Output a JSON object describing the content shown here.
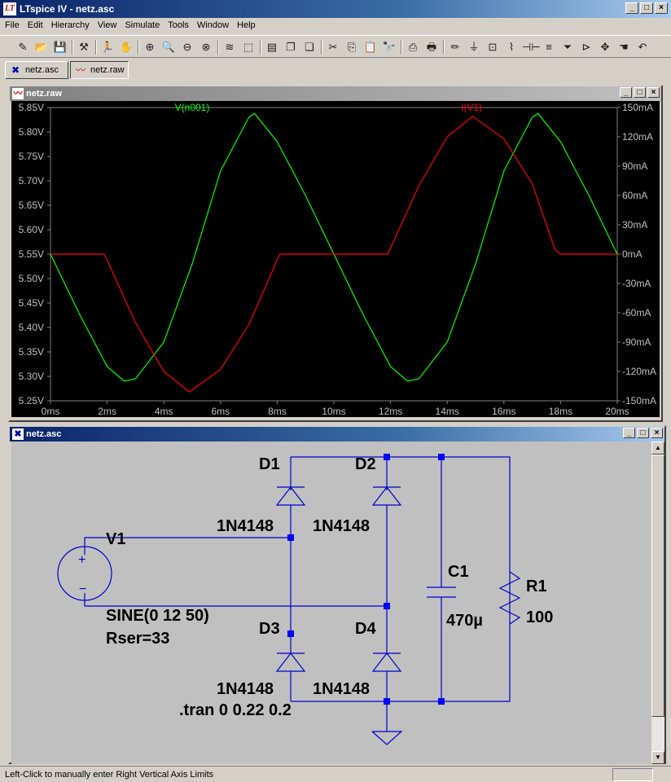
{
  "window": {
    "title": "LTspice IV - netz.asc",
    "app_icon_glyph": "LT"
  },
  "menu": [
    "File",
    "Edit",
    "Hierarchy",
    "View",
    "Simulate",
    "Tools",
    "Window",
    "Help"
  ],
  "toolbar": [
    {
      "icon": "new-schematic-icon",
      "glyph": "✎"
    },
    {
      "icon": "open-icon",
      "glyph": "📂"
    },
    {
      "icon": "save-icon",
      "glyph": "💾"
    },
    {
      "icon": "control-panel-icon",
      "glyph": "⚒"
    },
    {
      "icon": "run-icon",
      "glyph": "🏃"
    },
    {
      "icon": "halt-icon",
      "glyph": "✋"
    },
    {
      "icon": "zoom-in-icon",
      "glyph": "⊕"
    },
    {
      "icon": "pan-icon",
      "glyph": "🔍"
    },
    {
      "icon": "zoom-out-icon",
      "glyph": "⊖"
    },
    {
      "icon": "zoom-cancel-icon",
      "glyph": "⊗"
    },
    {
      "icon": "autorange-icon",
      "glyph": "≋"
    },
    {
      "icon": "fit-icon",
      "glyph": "⬚"
    },
    {
      "icon": "tile-horizontal-icon",
      "glyph": "▤"
    },
    {
      "icon": "cascade-icon",
      "glyph": "❐"
    },
    {
      "icon": "close-windows-icon",
      "glyph": "❏"
    },
    {
      "icon": "cut-icon",
      "glyph": "✂"
    },
    {
      "icon": "copy-icon",
      "glyph": "⎘"
    },
    {
      "icon": "paste-icon",
      "glyph": "📋"
    },
    {
      "icon": "find-icon",
      "glyph": "🔭"
    },
    {
      "icon": "print-setup-icon",
      "glyph": "⎙"
    },
    {
      "icon": "print-icon",
      "glyph": "🖶"
    },
    {
      "icon": "wire-icon",
      "glyph": "✏"
    },
    {
      "icon": "ground-icon",
      "glyph": "⏚"
    },
    {
      "icon": "label-net-icon",
      "glyph": "⊡"
    },
    {
      "icon": "resistor-icon",
      "glyph": "⌇"
    },
    {
      "icon": "capacitor-icon",
      "glyph": "⊣⊢"
    },
    {
      "icon": "inductor-icon",
      "glyph": "≡"
    },
    {
      "icon": "diode-icon",
      "glyph": "⏷"
    },
    {
      "icon": "component-icon",
      "glyph": "⊳"
    },
    {
      "icon": "move-icon",
      "glyph": "✥"
    },
    {
      "icon": "drag-icon",
      "glyph": "☚"
    },
    {
      "icon": "undo-icon",
      "glyph": "↶"
    }
  ],
  "tabs": [
    {
      "label": "netz.asc",
      "icon": "schematic-tab-icon"
    },
    {
      "label": "netz.raw",
      "icon": "waveform-tab-icon"
    }
  ],
  "plot_window": {
    "title": "netz.raw"
  },
  "schematic_window": {
    "title": "netz.asc"
  },
  "chart_data": {
    "type": "line",
    "title": "",
    "xlabel": "",
    "xlim": [
      0,
      20
    ],
    "x_ticks": [
      "0ms",
      "2ms",
      "4ms",
      "6ms",
      "8ms",
      "10ms",
      "12ms",
      "14ms",
      "16ms",
      "18ms",
      "20ms"
    ],
    "left_axis": {
      "ylim": [
        5.25,
        5.85
      ],
      "ticks": [
        "5.85V",
        "5.80V",
        "5.75V",
        "5.70V",
        "5.65V",
        "5.60V",
        "5.55V",
        "5.50V",
        "5.45V",
        "5.40V",
        "5.35V",
        "5.30V",
        "5.25V"
      ]
    },
    "right_axis": {
      "ylim": [
        -150,
        150
      ],
      "ticks": [
        "150mA",
        "120mA",
        "90mA",
        "60mA",
        "30mA",
        "0mA",
        "-30mA",
        "-60mA",
        "-90mA",
        "-120mA",
        "-150mA"
      ]
    },
    "background": "#000000",
    "grid": false,
    "series": [
      {
        "name": "V(n001)",
        "axis": "left",
        "color": "#00ff00",
        "x": [
          0,
          1,
          2,
          2.6,
          3,
          4,
          5,
          6,
          7,
          7.2,
          8,
          9,
          10,
          11,
          12,
          12.6,
          13,
          14,
          15,
          16,
          17,
          17.2,
          18,
          19,
          20
        ],
        "y": [
          5.55,
          5.43,
          5.32,
          5.29,
          5.295,
          5.37,
          5.53,
          5.72,
          5.83,
          5.838,
          5.78,
          5.67,
          5.55,
          5.43,
          5.32,
          5.29,
          5.295,
          5.37,
          5.53,
          5.72,
          5.83,
          5.838,
          5.78,
          5.67,
          5.55
        ]
      },
      {
        "name": "I(V1)",
        "axis": "right",
        "color": "#ff0000",
        "x": [
          0,
          1,
          1.9,
          3,
          4,
          4.9,
          6,
          7,
          8,
          8.1,
          10,
          11,
          11.9,
          13,
          14,
          14.9,
          16,
          17,
          17.8,
          18,
          20
        ],
        "y": [
          0,
          0,
          0,
          -70,
          -120,
          -141,
          -118,
          -72,
          -6,
          0,
          0,
          0,
          0,
          70,
          120,
          141,
          118,
          72,
          5,
          0,
          0
        ]
      }
    ]
  },
  "schematic": {
    "labels": {
      "v1": "V1",
      "v1_spec1": "SINE(0 12 50)",
      "v1_spec2": "Rser=33",
      "d1": "D1",
      "d1_model": "1N4148",
      "d2": "D2",
      "d2_model": "1N4148",
      "d3": "D3",
      "d3_model": "1N4148",
      "d4": "D4",
      "d4_model": "1N4148",
      "c1": "C1",
      "c1_value": "470µ",
      "r1": "R1",
      "r1_value": "100",
      "tran": ".tran 0 0.22 0.2",
      "plus": "+",
      "minus": "−"
    },
    "wire_color": "#0000cc",
    "junction_color": "#0000ff"
  },
  "status": {
    "text": "Left-Click to manually enter Right Vertical Axis Limits"
  }
}
